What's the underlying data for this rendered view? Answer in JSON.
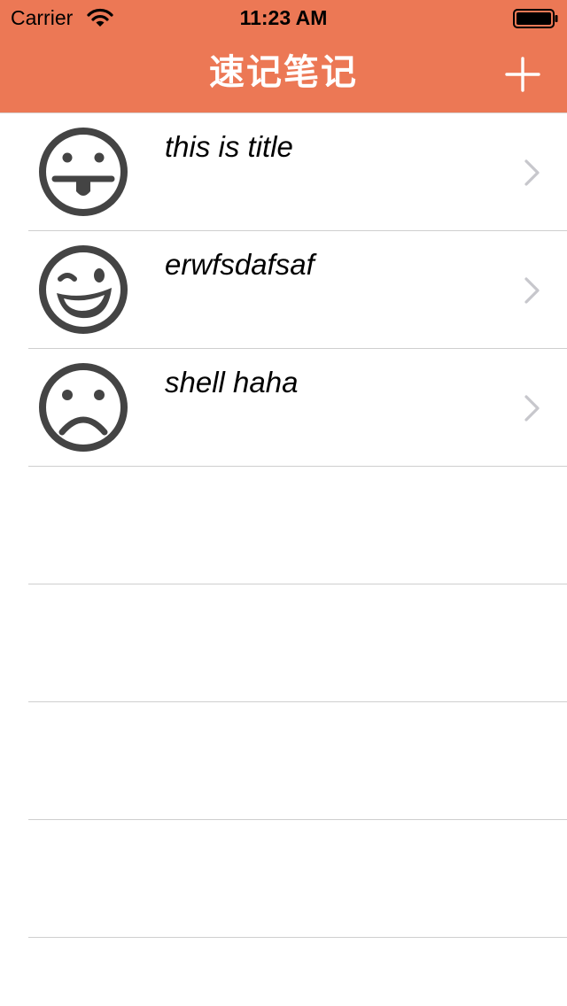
{
  "status_bar": {
    "carrier": "Carrier",
    "time": "11:23 AM",
    "wifi_icon": "wifi-icon",
    "battery_icon": "battery-icon"
  },
  "navbar": {
    "title": "速记笔记",
    "add_icon": "plus-icon",
    "background_color": "#ec7855"
  },
  "notes": [
    {
      "title": "this is title",
      "icon": "tongue-out-face-icon"
    },
    {
      "title": "erwfsdafsaf",
      "icon": "winking-face-icon"
    },
    {
      "title": "shell haha",
      "icon": "sad-face-icon"
    }
  ]
}
